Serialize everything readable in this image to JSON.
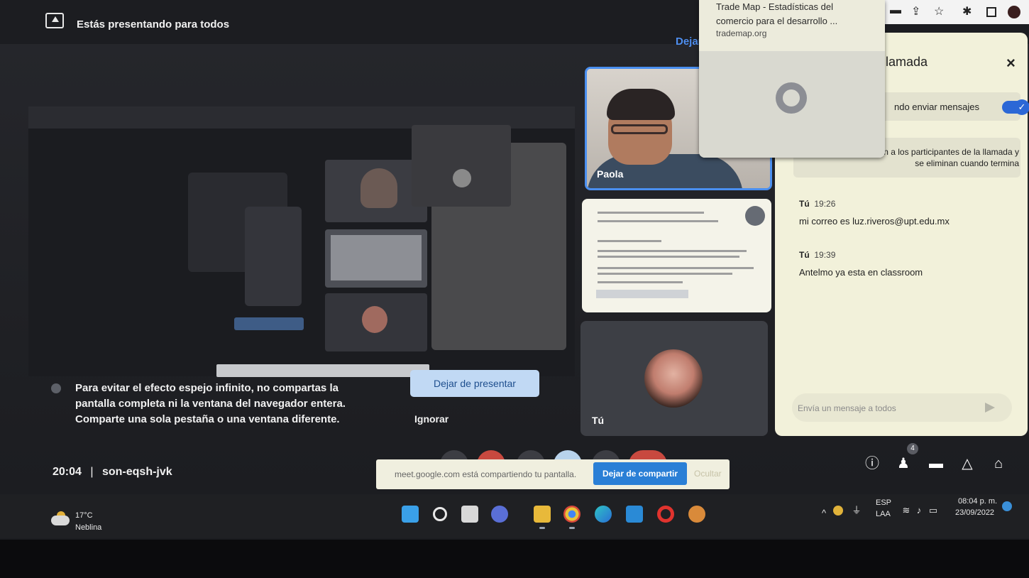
{
  "banner": {
    "text": "Estás presentando para todos",
    "stop_link": "Dejar"
  },
  "popup": {
    "title": "Trade Map - Estadísticas del comercio para el desarrollo ...",
    "url": "trademap.org"
  },
  "tiles": {
    "paola_name": "Paola",
    "self_name": "Tú"
  },
  "chat": {
    "title": "llamada",
    "close": "×",
    "toggle_label": "ndo enviar mensajes",
    "notice": "se muestran a los participantes de la llamada y se eliminan cuando termina",
    "messages": [
      {
        "sender": "Tú",
        "time": "19:26",
        "text": "mi correo es luz.riveros@upt.edu.mx"
      },
      {
        "sender": "Tú",
        "time": "19:39",
        "text": "Antelmo ya esta en classroom"
      }
    ],
    "input_placeholder": "Envía un mensaje a todos"
  },
  "warning": {
    "text": "Para evitar el efecto espejo infinito, no compartas la pantalla completa ni la ventana del navegador entera. Comparte una sola pestaña o una ventana diferente.",
    "stop_button": "Dejar de presentar",
    "ignore_button": "Ignorar"
  },
  "meeting": {
    "time": "20:04",
    "separator": "|",
    "code": "son-eqsh-jvk",
    "participants_badge": "4"
  },
  "sharebar": {
    "text": "meet.google.com está compartiendo tu pantalla.",
    "stop_button": "Dejar de compartir",
    "hide": "Ocultar"
  },
  "taskbar": {
    "temperature": "17°C",
    "condition": "Neblina",
    "language_top": "ESP",
    "language_bottom": "LAA",
    "clock_time": "08:04 p. m.",
    "clock_date": "23/09/2022"
  },
  "colors": {
    "accent_blue": "#2a7fd6",
    "chat_bg": "#f2f1da",
    "end_call_red": "#c8493f",
    "tile_highlight": "#4a8ff0"
  }
}
